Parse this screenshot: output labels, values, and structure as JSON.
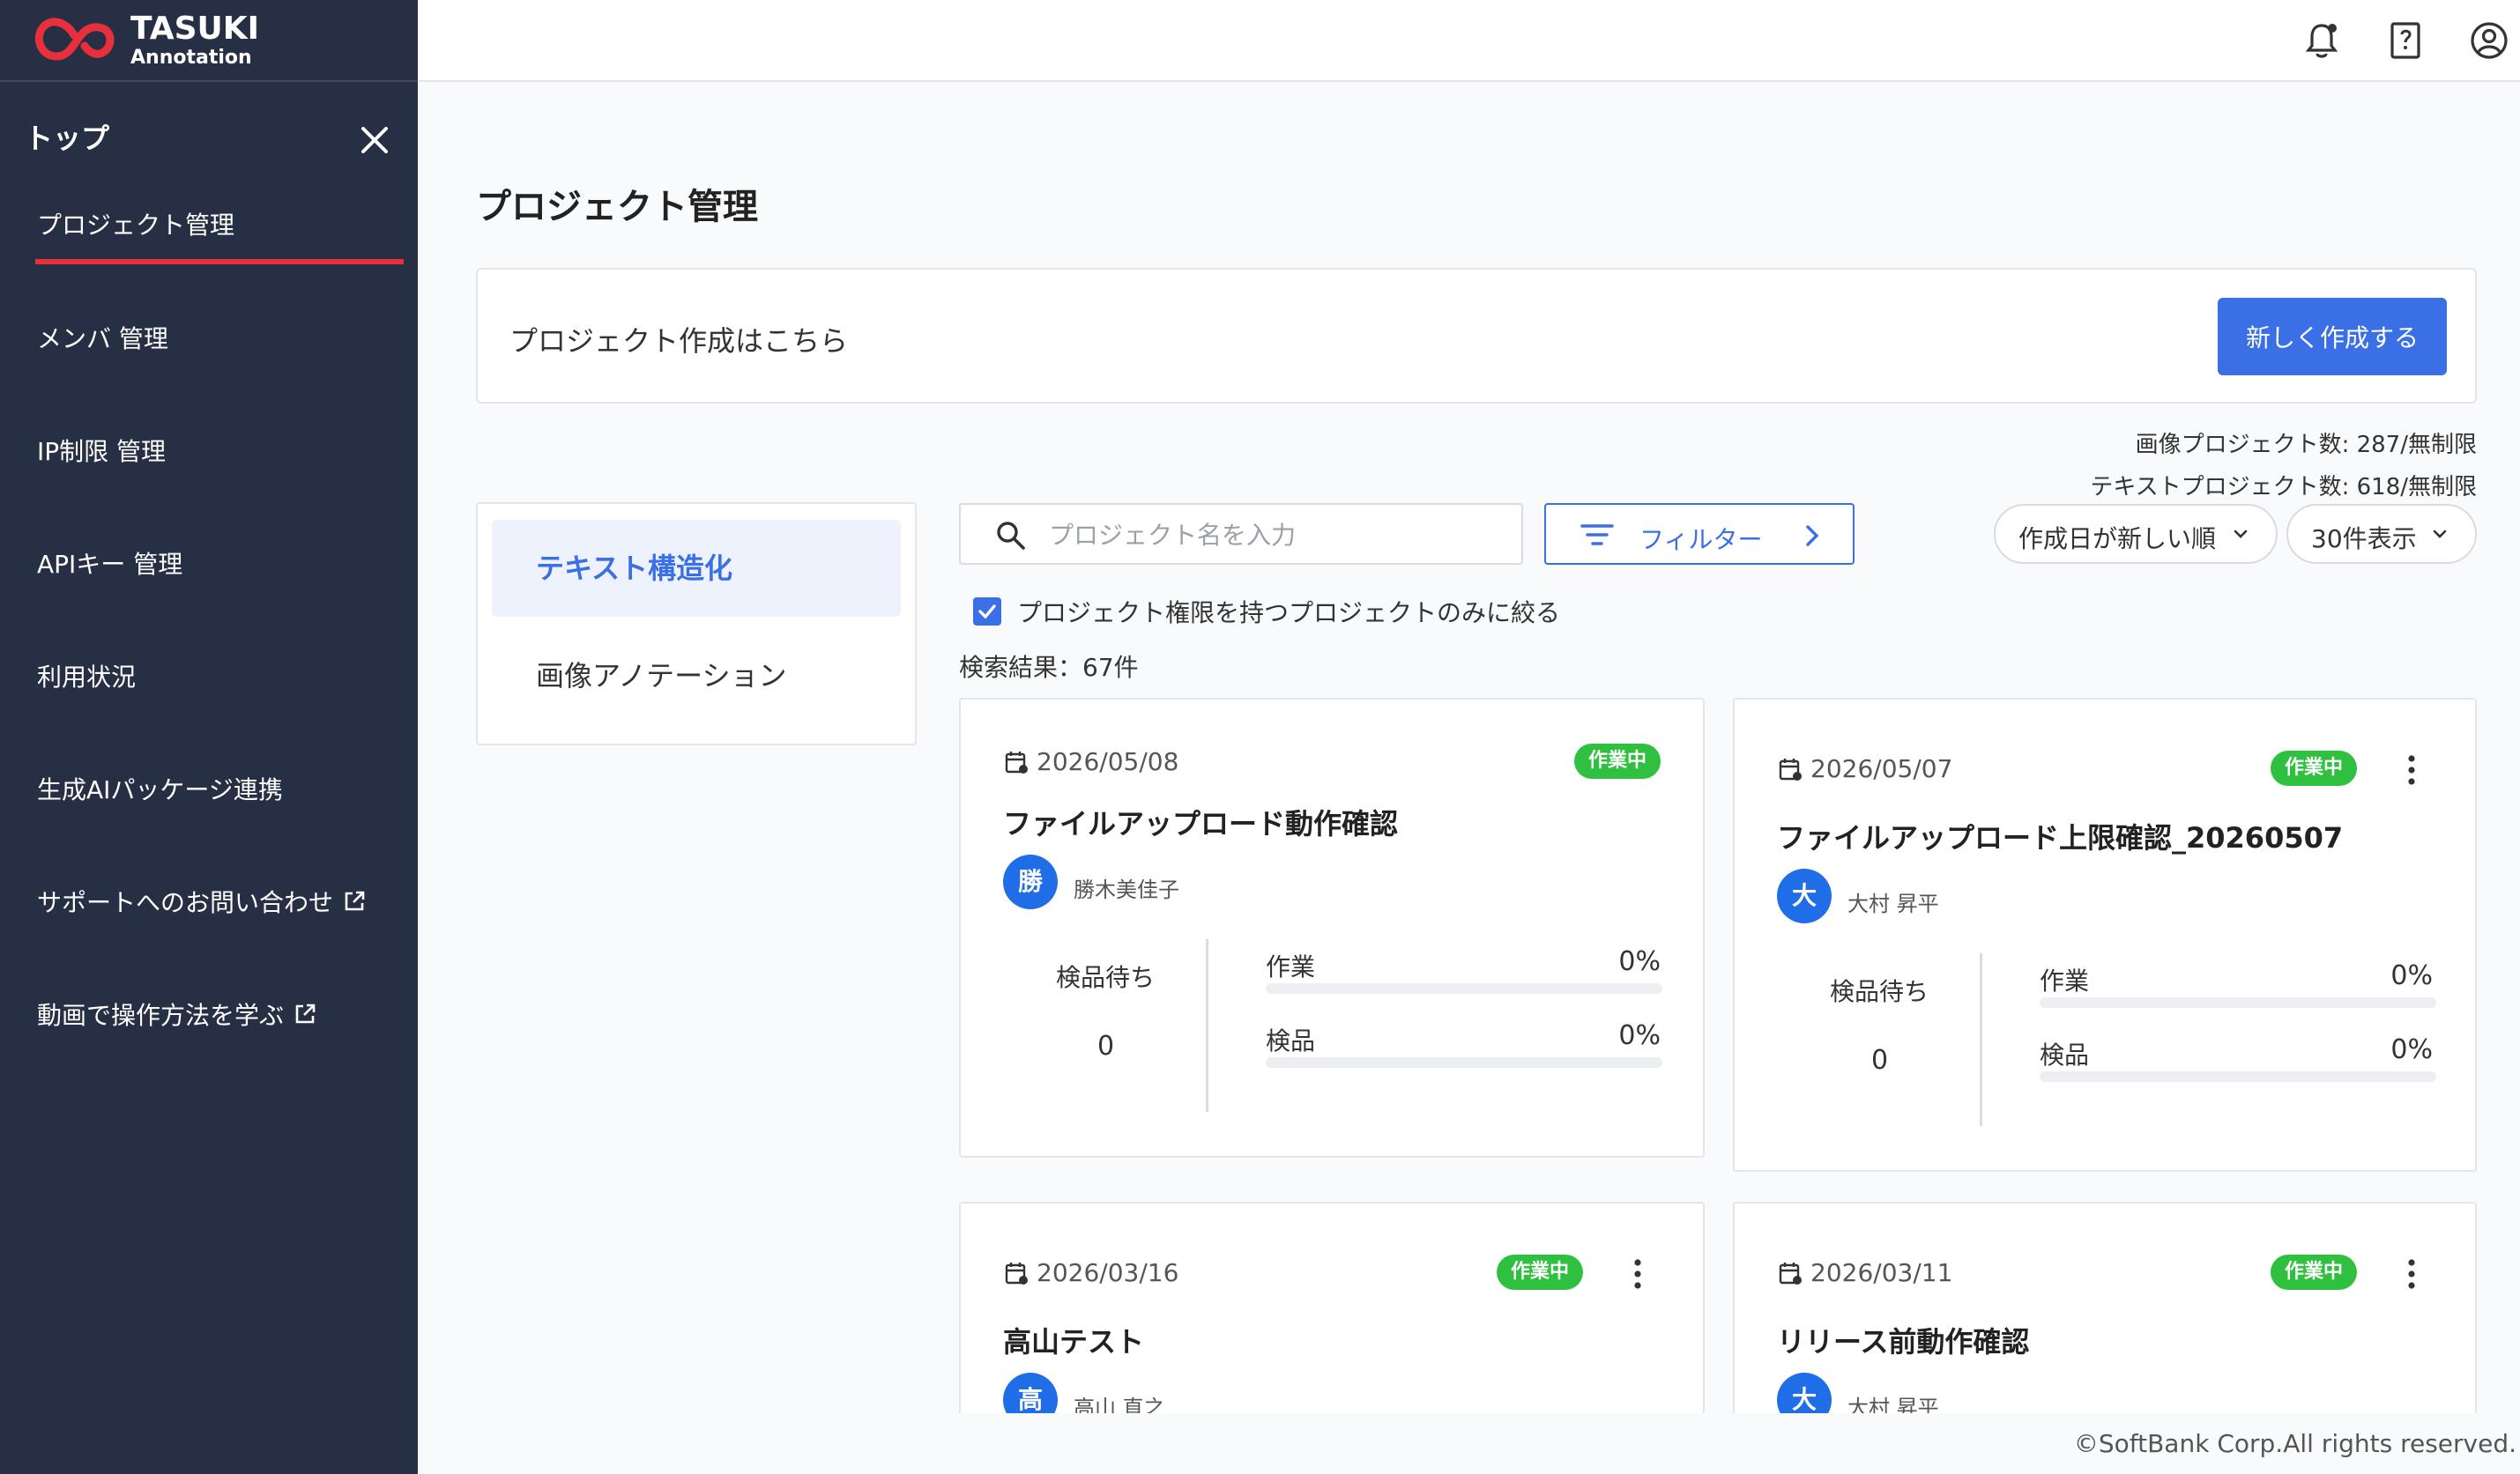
{
  "app": {
    "logo_main": "TASUKI",
    "logo_sub": "Annotation",
    "brand_color": "#e8303c",
    "accent_color": "#3a6fe6"
  },
  "sidebar": {
    "heading": "トップ",
    "items": [
      {
        "label": "プロジェクト管理",
        "active": true
      },
      {
        "label": "メンバ 管理"
      },
      {
        "label": "IP制限 管理"
      },
      {
        "label": "APIキー 管理"
      },
      {
        "label": "利用状況"
      },
      {
        "label": "生成AIパッケージ連携"
      },
      {
        "label": "サポートへのお問い合わせ",
        "external": true
      },
      {
        "label": "動画で操作方法を学ぶ",
        "external": true
      }
    ]
  },
  "header": {
    "icons": [
      "notification-bell-icon",
      "help-book-icon",
      "account-icon"
    ]
  },
  "main": {
    "title": "プロジェクト管理",
    "create_label": "プロジェクト作成はこちら",
    "create_button": "新しく作成する",
    "image_count": "画像プロジェクト数: 287/無制限",
    "text_count": "テキストプロジェクト数: 618/無制限",
    "categories": [
      "テキスト構造化",
      "画像アノテーション"
    ],
    "search_placeholder": "プロジェクト名を入力",
    "filter_label": "フィルター",
    "sort_label": "作成日が新しい順",
    "per_page_label": "30件表示",
    "permission_filter": "プロジェクト権限を持つプロジェクトのみに絞る",
    "result_text": "検索結果：67件"
  },
  "cards": [
    {
      "date": "2026/05/08",
      "status": "作業中",
      "title": "ファイルアップロード動作確認",
      "avatar": "勝",
      "owner": "勝木美佳子",
      "pending_label": "検品待ち",
      "pending_value": "0",
      "work_label": "作業",
      "work_value": "0%",
      "inspect_label": "検品",
      "inspect_value": "0%"
    },
    {
      "date": "2026/05/07",
      "status": "作業中",
      "title": "ファイルアップロード上限確認_20260507",
      "avatar": "大",
      "owner": "大村 昇平",
      "pending_label": "検品待ち",
      "pending_value": "0",
      "work_label": "作業",
      "work_value": "0%",
      "inspect_label": "検品",
      "inspect_value": "0%"
    },
    {
      "date": "2026/03/16",
      "status": "作業中",
      "title": "高山テスト",
      "avatar": "高",
      "owner": "高山 直之"
    },
    {
      "date": "2026/03/11",
      "status": "作業中",
      "title": "リリース前動作確認",
      "avatar": "大",
      "owner": "大村 昇平"
    }
  ],
  "footer": "©SoftBank Corp.All rights reserved."
}
